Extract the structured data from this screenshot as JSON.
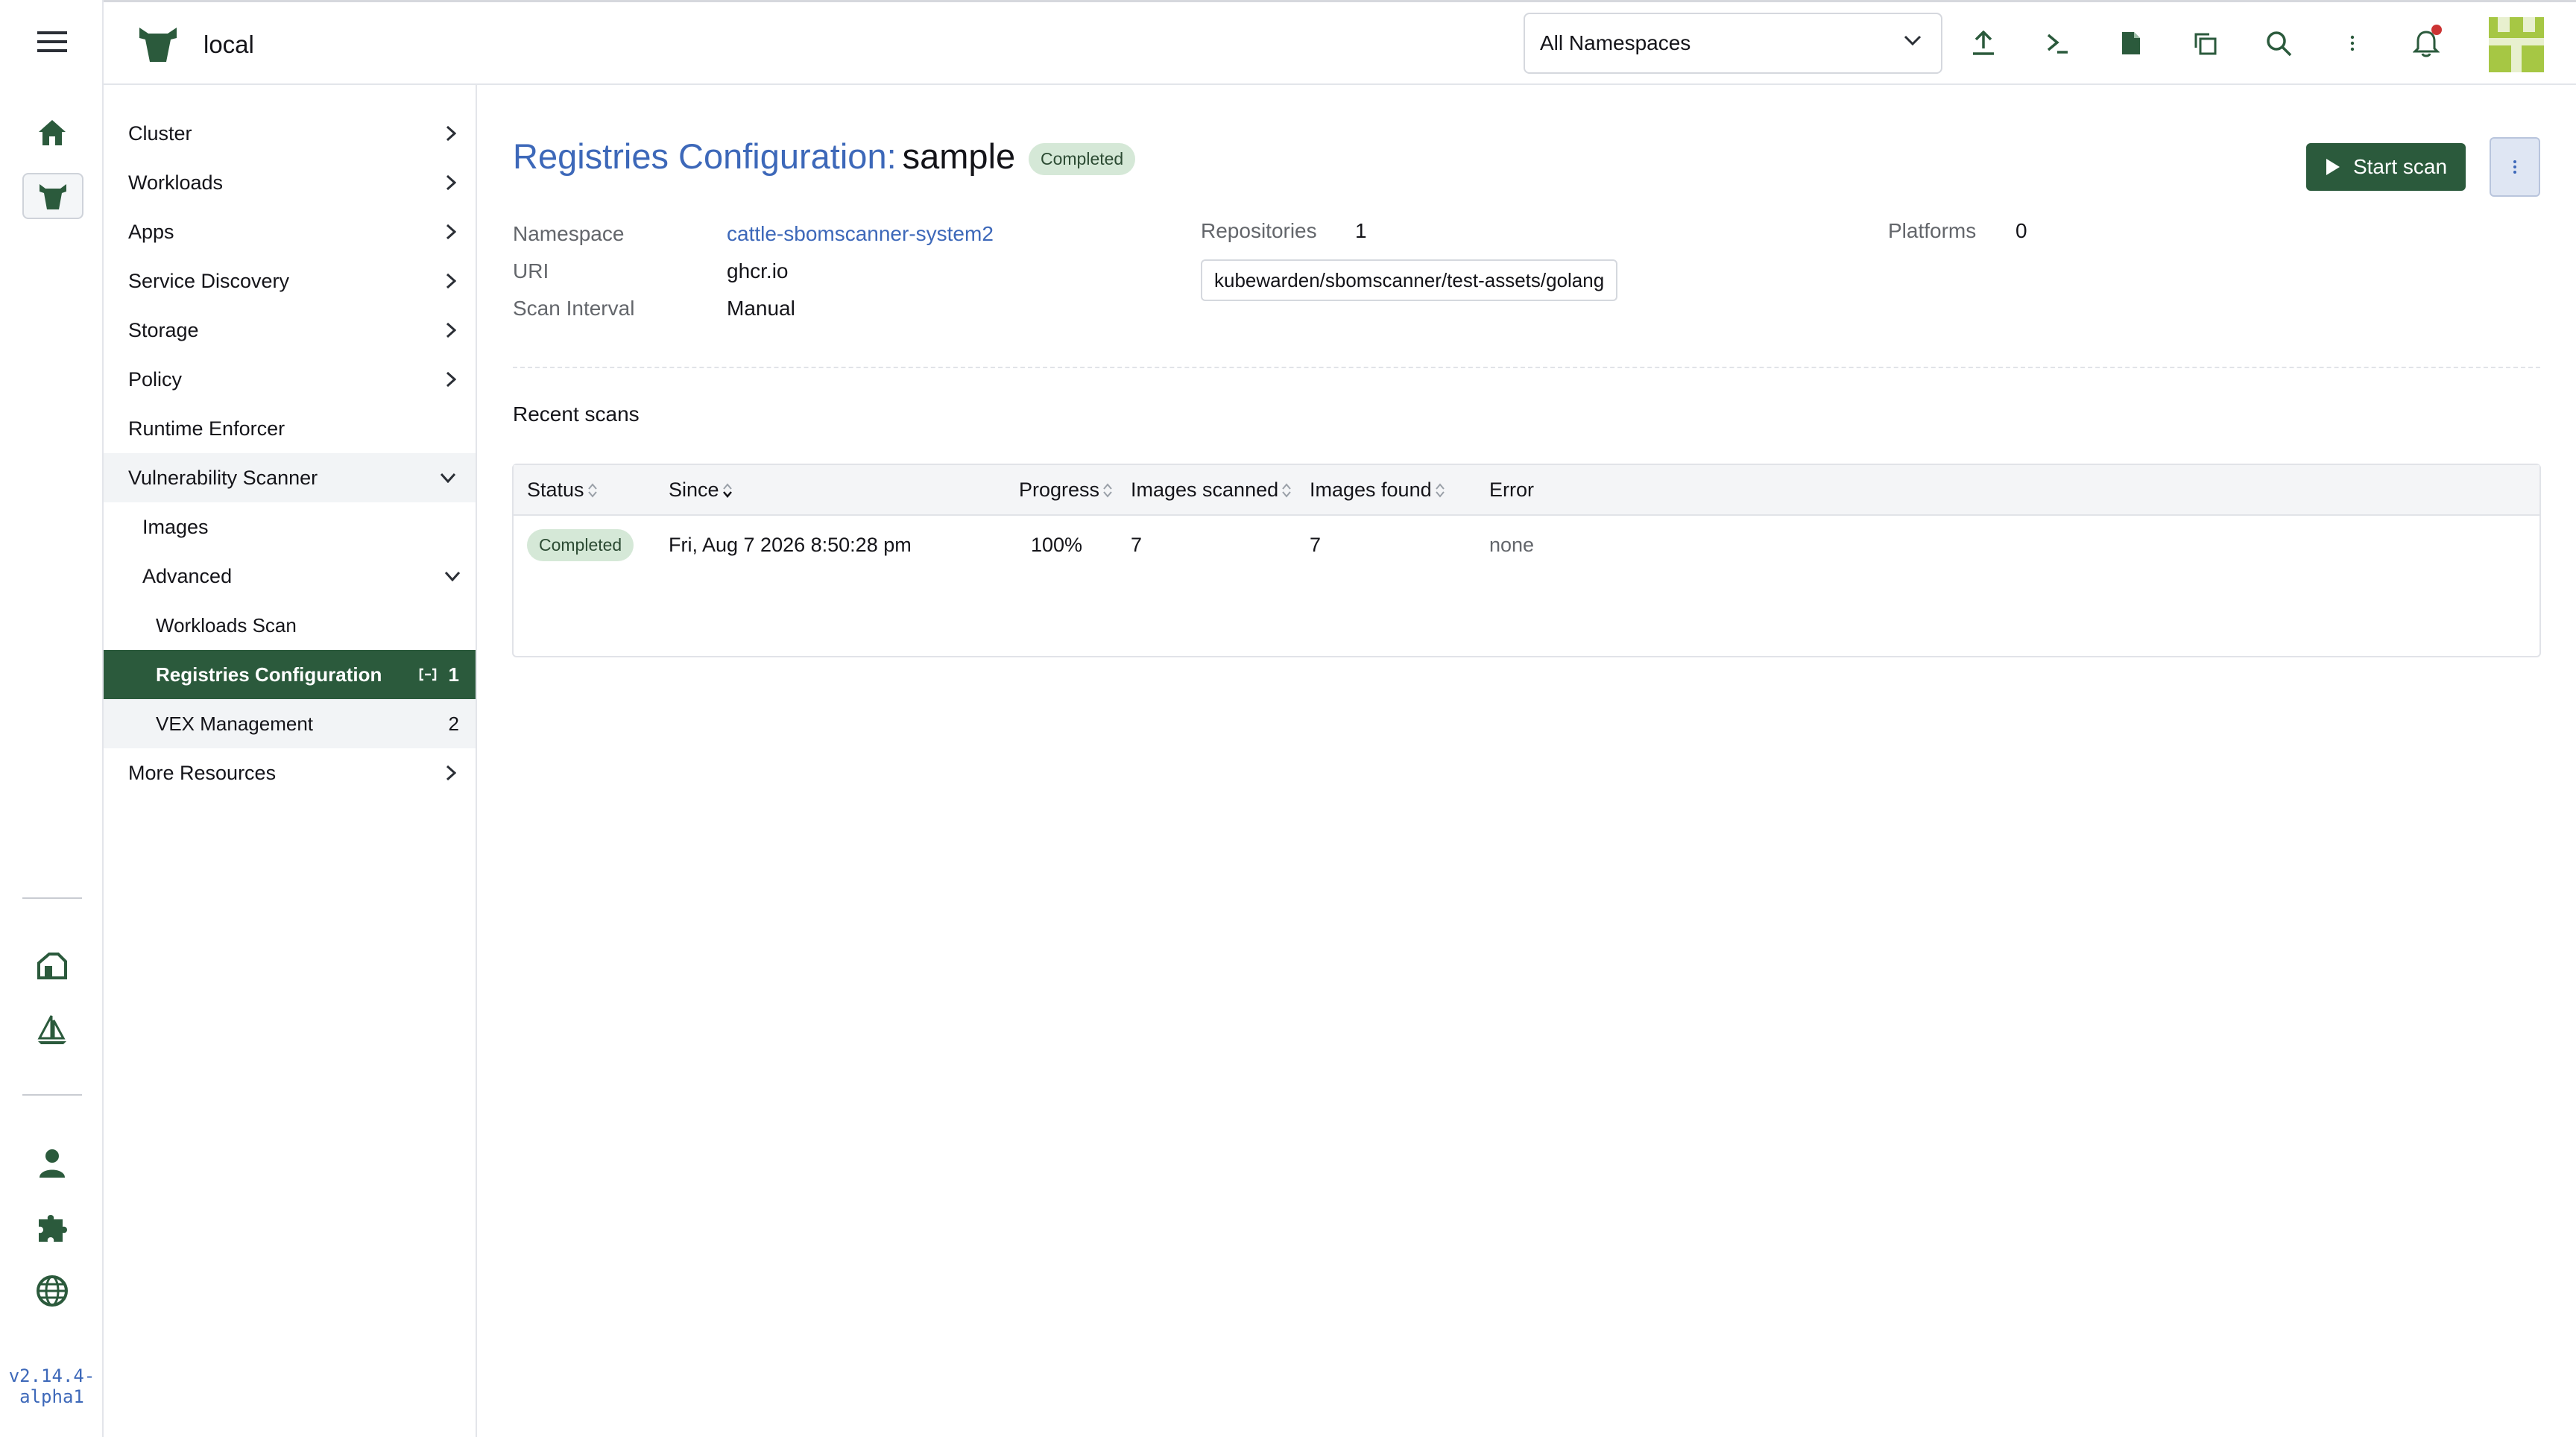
{
  "header": {
    "cluster_name": "local",
    "namespace_select": "All Namespaces"
  },
  "rail": {
    "version_line1": "v2.14.4-",
    "version_line2": "alpha1"
  },
  "sidenav": {
    "items": [
      {
        "label": "Cluster"
      },
      {
        "label": "Workloads"
      },
      {
        "label": "Apps"
      },
      {
        "label": "Service Discovery"
      },
      {
        "label": "Storage"
      },
      {
        "label": "Policy"
      },
      {
        "label": "Runtime Enforcer"
      },
      {
        "label": "Vulnerability Scanner"
      },
      {
        "label": "Images"
      },
      {
        "label": "Advanced"
      },
      {
        "label": "Workloads Scan"
      },
      {
        "label": "Registries Configuration",
        "count": "1"
      },
      {
        "label": "VEX Management",
        "count": "2"
      },
      {
        "label": "More Resources"
      }
    ]
  },
  "page": {
    "title_prefix": "Registries Configuration:",
    "title_name": "sample",
    "status": "Completed",
    "start_scan_label": "Start scan",
    "details": {
      "namespace_label": "Namespace",
      "namespace_value": "cattle-sbomscanner-system2",
      "uri_label": "URI",
      "uri_value": "ghcr.io",
      "interval_label": "Scan Interval",
      "interval_value": "Manual",
      "repositories_label": "Repositories",
      "repositories_value": "1",
      "repository_tag": "kubewarden/sbomscanner/test-assets/golang",
      "platforms_label": "Platforms",
      "platforms_value": "0"
    },
    "recent_scans": {
      "title": "Recent scans",
      "columns": [
        "Status",
        "Since",
        "Progress",
        "Images scanned",
        "Images found",
        "Error"
      ],
      "rows": [
        {
          "status": "Completed",
          "since": "Fri, Aug 7 2026  8:50:28 pm",
          "progress": "100%",
          "images_scanned": "7",
          "images_found": "7",
          "error": "none"
        }
      ]
    }
  },
  "colors": {
    "accent_green": "#2b5a3c",
    "link_blue": "#3d68b9",
    "badge_bg": "#d5e8d7"
  }
}
